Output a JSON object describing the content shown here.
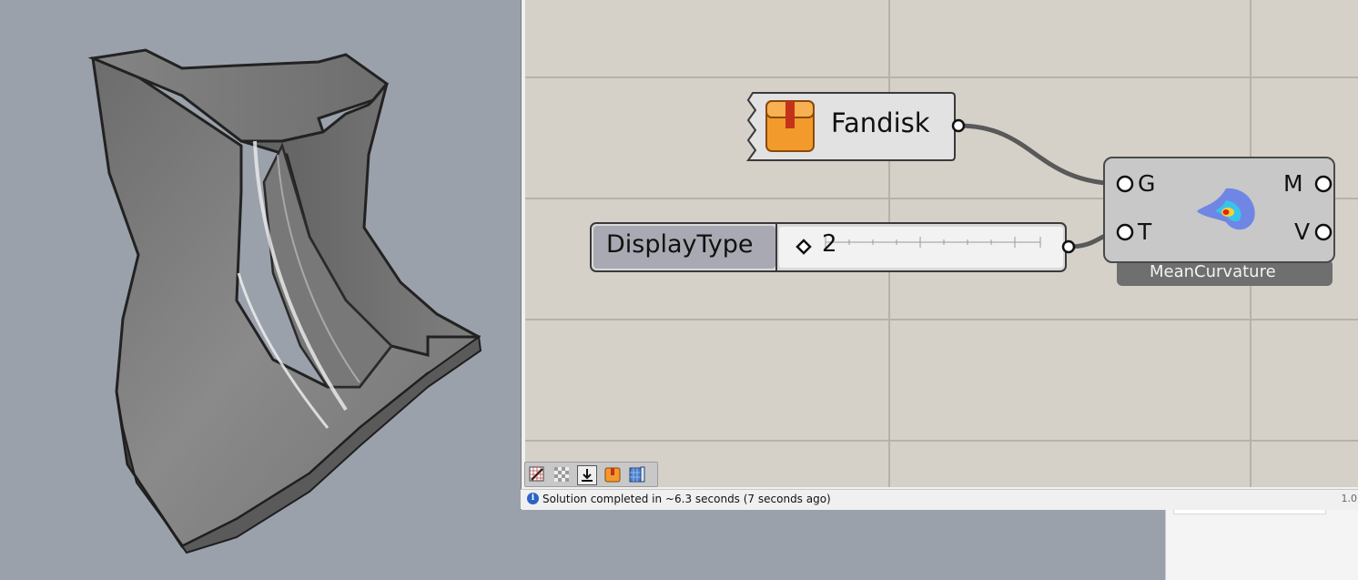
{
  "viewport": {
    "object": "fandisk-mesh"
  },
  "canvas": {
    "nodes": {
      "fandisk": {
        "label": "Fandisk",
        "icon": "package-icon"
      },
      "display_type": {
        "label": "DisplayType",
        "value": "2",
        "slider_fraction": 0.0
      },
      "mean_curvature": {
        "title": "MeanCurvature",
        "inputs": [
          "G",
          "T"
        ],
        "outputs": [
          "M",
          "V"
        ],
        "icon": "curvature-blob-icon"
      }
    }
  },
  "toolbar": {
    "buttons": [
      "sketch-icon",
      "checker-icon",
      "bake-icon",
      "package-icon",
      "viewport-icon"
    ]
  },
  "status": {
    "message": "Solution completed in ~6.3 seconds (7 seconds ago)",
    "version": "1.0"
  },
  "colors": {
    "canvas_bg": "#d5d1c9",
    "node_fill": "#c8c8c8",
    "component_title_bg": "#6f6f6f",
    "wire": "#595959",
    "fandisk_icon": "#f39a2c"
  }
}
